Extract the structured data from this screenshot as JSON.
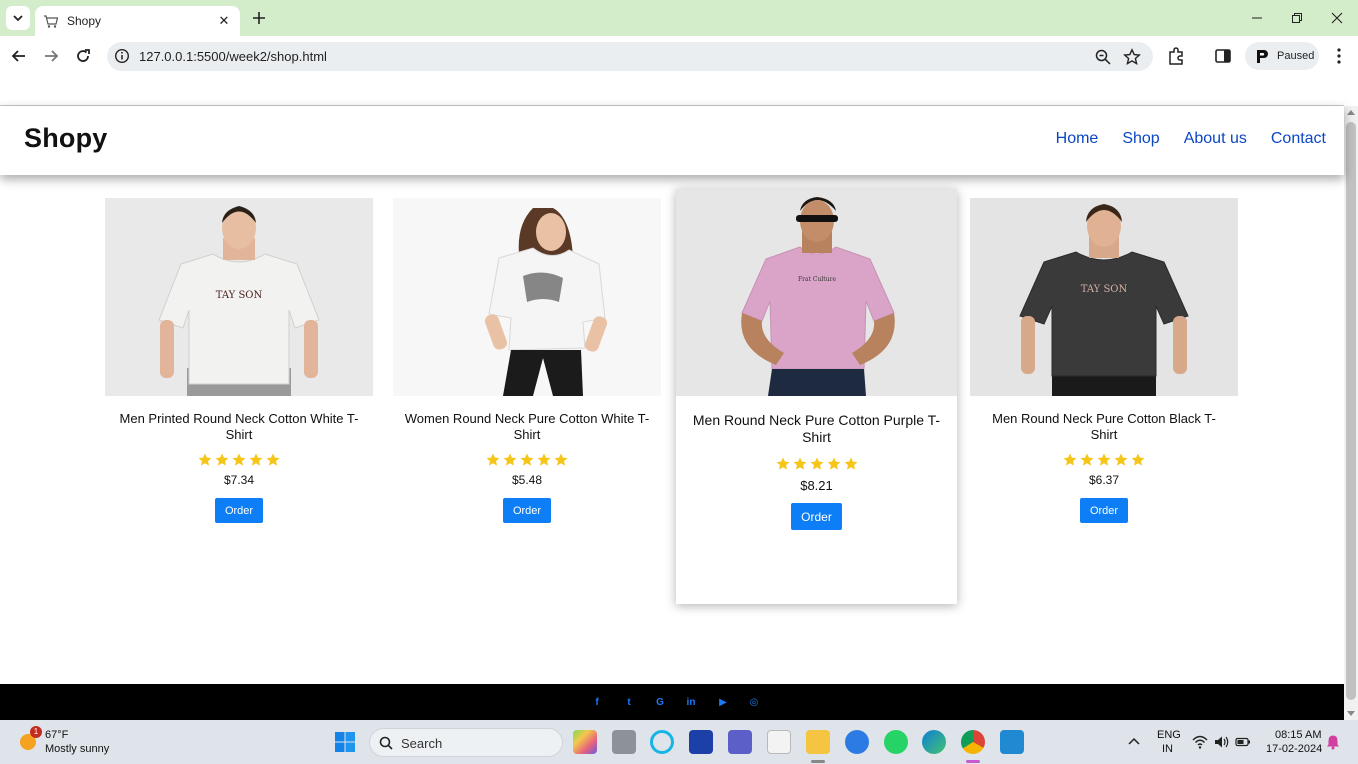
{
  "browser": {
    "tab_title": "Shopy",
    "url": "127.0.0.1:5500/week2/shop.html",
    "profile_label": "Paused"
  },
  "site": {
    "logo": "Shopy",
    "nav": [
      "Home",
      "Shop",
      "About us",
      "Contact"
    ]
  },
  "products": [
    {
      "name": "Men Printed Round Neck Cotton White T-Shirt",
      "rating": 5,
      "price": "$7.34",
      "order_label": "Order",
      "shirt_color": "#f2f2f0",
      "bg": "#e9e9e9",
      "print": "TAY SON"
    },
    {
      "name": "Women Round Neck Pure Cotton White T-Shirt",
      "rating": 5,
      "price": "$5.48",
      "order_label": "Order",
      "shirt_color": "#f5f5f5",
      "bg": "#f7f7f7",
      "print": ""
    },
    {
      "name": "Men Round Neck Pure Cotton Purple T-Shirt",
      "rating": 5,
      "price": "$8.21",
      "order_label": "Order",
      "shirt_color": "#d9a4c8",
      "bg": "#e6e6e6",
      "print": ""
    },
    {
      "name": "Men Round Neck Pure Cotton Black T-Shirt",
      "rating": 5,
      "price": "$6.37",
      "order_label": "Order",
      "shirt_color": "#3a3a3a",
      "bg": "#e4e4e4",
      "print": "TAY SON"
    }
  ],
  "footer": {
    "social_icons": [
      "facebook-icon",
      "twitter-icon",
      "google-icon",
      "linkedin-icon",
      "youtube-icon",
      "instagram-icon"
    ],
    "social_glyphs": [
      "f",
      "t",
      "G",
      "in",
      "▶",
      "◎"
    ],
    "icon_color": "#1a7af8"
  },
  "taskbar": {
    "weather_badge": "1",
    "weather_temp": "67°F",
    "weather_desc": "Mostly sunny",
    "search_label": "Search",
    "lang_line1": "ENG",
    "lang_line2": "IN",
    "time": "08:15 AM",
    "date": "17-02-2024"
  },
  "colors": {
    "accent": "#0d7ef5",
    "nav_link": "#0b47c4",
    "star": "#f5c518",
    "tab_strip": "#d3ecc9"
  }
}
